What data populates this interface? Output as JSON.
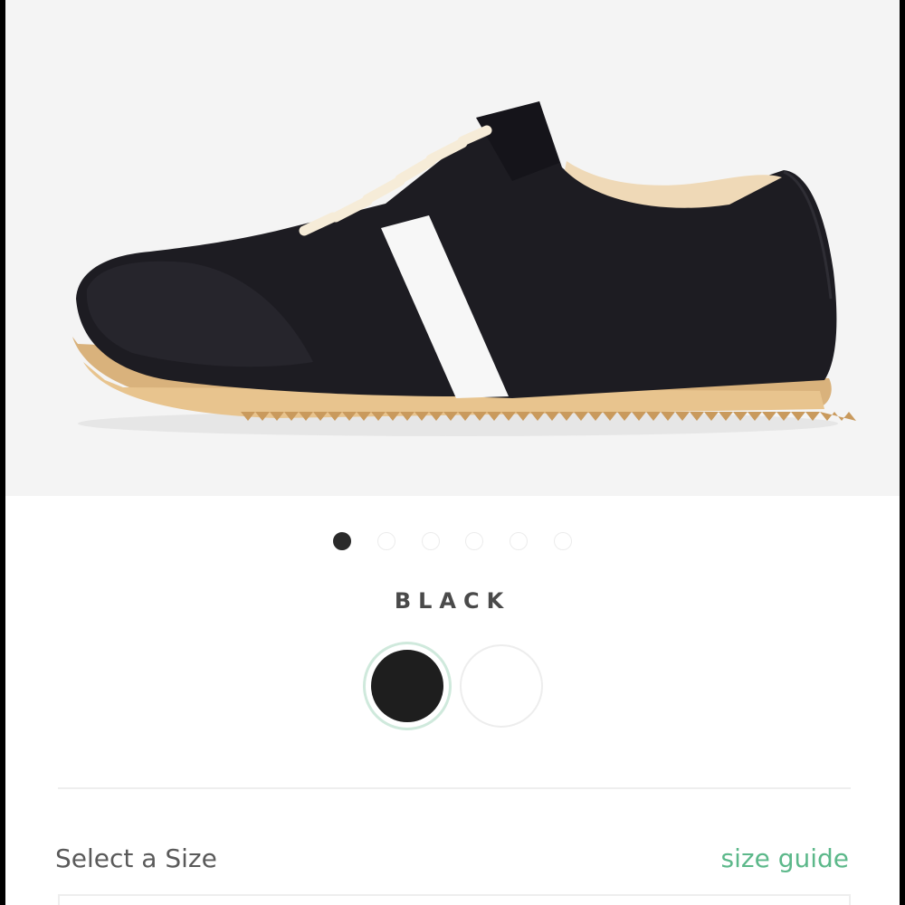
{
  "product": {
    "images": {
      "count": 6,
      "active_index": 0
    },
    "color": {
      "selected_label": "BLACK",
      "options": [
        {
          "name": "black",
          "hex": "#1e1e1e",
          "selected": true
        },
        {
          "name": "white",
          "hex": "#ffffff",
          "selected": false
        }
      ]
    },
    "size": {
      "label": "Select a Size",
      "guide_label": "size guide"
    }
  },
  "colors": {
    "accent": "#5cb88a",
    "selection_ring": "#cfe9dc",
    "text": "#5a5a5a"
  }
}
